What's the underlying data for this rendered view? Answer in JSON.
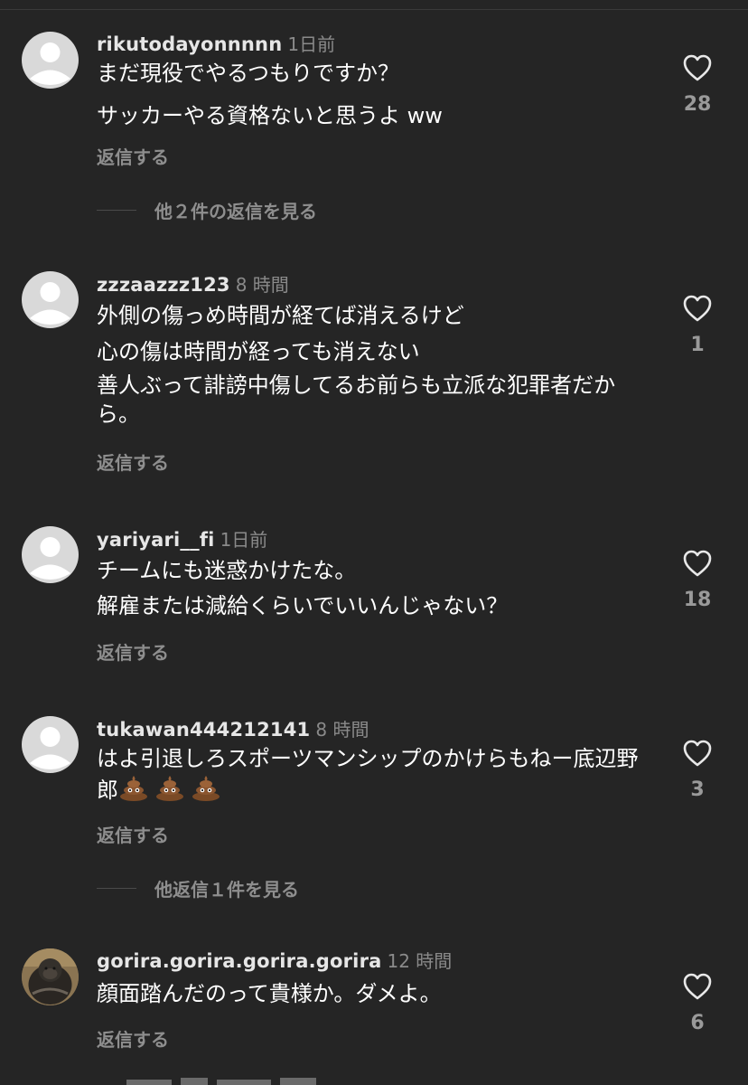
{
  "reply_label": "返信する",
  "comments": [
    {
      "username": "rikutodayonnnnn",
      "time": "1日前",
      "lines": [
        "まだ現役でやるつもりですか？",
        "サッカーやる資格ないと思うよ ww"
      ],
      "likes": "28",
      "more_replies": "他２件の返信を見る"
    },
    {
      "username": "zzzaazzz123",
      "time": "8 時間",
      "lines": [
        "外側の傷っめ時間が経てば消えるけど",
        "心の傷は時間が経っても消えない",
        "善人ぶって誹謗中傷してるお前らも立派な犯罪者だから。"
      ],
      "likes": "1"
    },
    {
      "username": "yariyari__fi",
      "time": "1日前",
      "lines": [
        "チームにも迷惑かけたな。",
        "解雇または減給くらいでいいんじゃない？"
      ],
      "likes": "18"
    },
    {
      "username": "tukawan444212141",
      "time": "8 時間",
      "lines": [
        "はよ引退しろスポーツマンシップのかけらもねー底辺野郎"
      ],
      "emojis": [
        "pile-of-poo",
        "pile-of-poo",
        "pile-of-poo"
      ],
      "likes": "3",
      "more_replies": "他返信１件を見る"
    },
    {
      "username": "gorira.gorira.gorira.gorira",
      "time": "12 時間",
      "lines": [
        "顔面踏んだのって貴様か。ダメよ。"
      ],
      "likes": "6",
      "avatar": "gorilla-photo"
    }
  ],
  "colors": {
    "background": "#252525",
    "username": "#e6e6e6",
    "secondary": "#8e8e8e",
    "avatar_placeholder": "#d9d9d9"
  }
}
